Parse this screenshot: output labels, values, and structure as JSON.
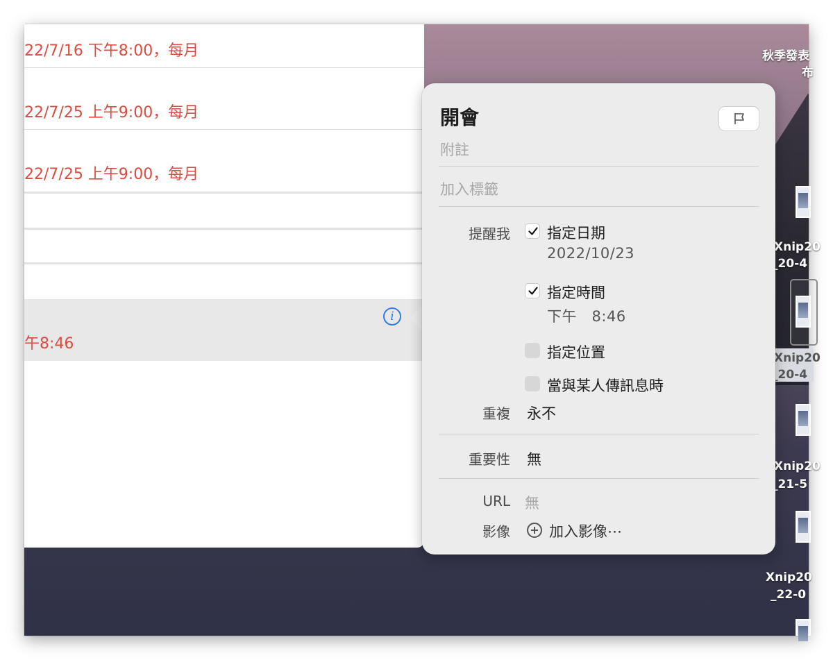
{
  "colors": {
    "accent_red": "#d94c42",
    "info_blue": "#2f7fe0"
  },
  "list": {
    "rows": [
      {
        "text": "22/7/16 下午8:00，每月"
      },
      {
        "text": "22/7/25 上午9:00，每月"
      },
      {
        "text": "22/7/25 上午9:00，每月"
      }
    ],
    "selected_row": {
      "text": "午8:46"
    }
  },
  "desktop": {
    "label_top_1": "秋季發表",
    "label_top_2": "布",
    "files": [
      {
        "line1": "Xnip20",
        "line2": "_20-4"
      },
      {
        "line1": "Xnip20",
        "line2": "_20-4"
      },
      {
        "line1": "Xnip20",
        "line2": "_21-5"
      },
      {
        "line1": "Xnip20",
        "line2": "_22-0"
      }
    ]
  },
  "popover": {
    "title": "開會",
    "notes_placeholder": "附註",
    "tags_placeholder": "加入標籤",
    "remind_me_label": "提醒我",
    "on_date": {
      "label": "指定日期",
      "checked": true,
      "value": "2022/10/23"
    },
    "at_time": {
      "label": "指定時間",
      "checked": true,
      "value": "下午   8:46"
    },
    "at_location": {
      "label": "指定位置",
      "checked": false
    },
    "when_messaging": {
      "label": "當與某人傳訊息時",
      "checked": false
    },
    "repeat_label": "重複",
    "repeat_value": "永不",
    "priority_label": "重要性",
    "priority_value": "無",
    "url_label": "URL",
    "url_value": "無",
    "images_label": "影像",
    "add_image_label": "加入影像⋯"
  }
}
